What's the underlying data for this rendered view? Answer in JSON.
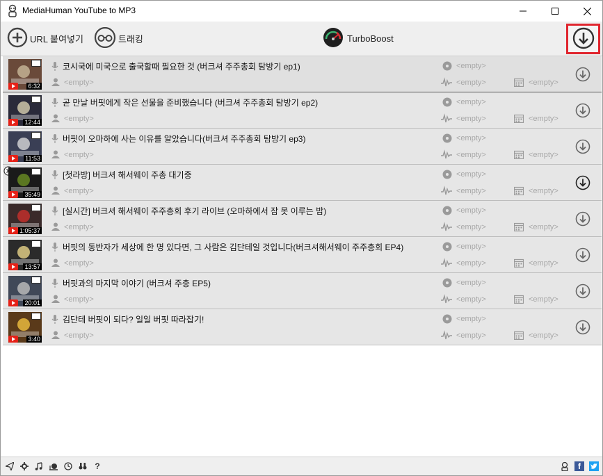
{
  "window": {
    "title": "MediaHuman YouTube to MP3"
  },
  "toolbar": {
    "paste_url_label": "URL 붙여넣기",
    "tracking_label": "트래킹",
    "turbo_label": "TurboBoost"
  },
  "rows": [
    {
      "title": "코시국에 미국으로 출국할때 필요한 것 (버크셔 주주총회 탐방기 ep1)",
      "duration": "6:32",
      "artist": "<empty>",
      "album": "<empty>",
      "genre": "<empty>",
      "year": "<empty>"
    },
    {
      "title": "곧 만날 버핏에게 작은 선물을 준비했습니다 (버크셔 주주총회 탐방기 ep2)",
      "duration": "12:44",
      "artist": "<empty>",
      "album": "<empty>",
      "genre": "<empty>",
      "year": "<empty>"
    },
    {
      "title": "버핏이 오마하에 사는 이유를 알았습니다(버크셔 주주총회 탐방기 ep3)",
      "duration": "11:53",
      "artist": "<empty>",
      "album": "<empty>",
      "genre": "<empty>",
      "year": "<empty>"
    },
    {
      "title": "[첫라방] 버크셔 해서웨이 주총 대기중",
      "duration": "35:49",
      "artist": "<empty>",
      "album": "<empty>",
      "genre": "<empty>",
      "year": "<empty>"
    },
    {
      "title": "[실시간] 버크셔 해서웨이 주주총회 후기 라이브 (오마하에서 잠 못 이루는 밤)",
      "duration": "1:05:37",
      "artist": "<empty>",
      "album": "<empty>",
      "genre": "<empty>",
      "year": "<empty>"
    },
    {
      "title": "버핏의 동반자가 세상에 한 명 있다면, 그 사람은 김단테일 것입니다(버크셔해서웨이 주주총회 EP4)",
      "duration": "13:57",
      "artist": "<empty>",
      "album": "<empty>",
      "genre": "<empty>",
      "year": "<empty>"
    },
    {
      "title": "버핏과의 마지막 이야기 (버크셔 주총 EP5)",
      "duration": "20:01",
      "artist": "<empty>",
      "album": "<empty>",
      "genre": "<empty>",
      "year": "<empty>"
    },
    {
      "title": "김단테 버핏이 되다? 일일 버핏 따라잡기!",
      "duration": "3:40",
      "artist": "<empty>",
      "album": "<empty>",
      "genre": "<empty>",
      "year": "<empty>"
    }
  ],
  "statusbar": {
    "icons": [
      "send-icon",
      "gear-icon",
      "music-note-icon",
      "snail-icon",
      "clock-icon",
      "binoculars-icon",
      "help-icon"
    ],
    "help_label": "?"
  },
  "colors": {
    "accent_red": "#e0262f",
    "youtube_red": "#e62117",
    "placeholder_gray": "#a8a8a8"
  }
}
